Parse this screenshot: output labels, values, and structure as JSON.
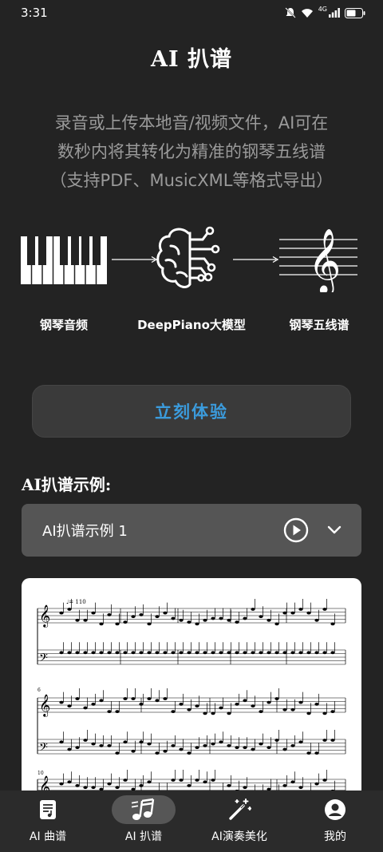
{
  "status": {
    "time": "3:31",
    "battery_icon": "battery-icon",
    "wifi_icon": "wifi-icon",
    "signal_icon": "signal-icon",
    "network_label": "4G"
  },
  "page": {
    "title": "AI 扒谱"
  },
  "description": [
    "录音或上传本地音/视频文件，AI可在",
    "数秒内将其转化为精准的钢琴五线谱",
    "（支持PDF、MusicXML等格式导出）"
  ],
  "pipeline": {
    "steps": [
      {
        "label": "钢琴音频",
        "icon": "piano-keys-icon"
      },
      {
        "label": "DeepPiano大模型",
        "icon": "brain-circuit-icon"
      },
      {
        "label": "钢琴五线谱",
        "icon": "treble-clef-staff-icon"
      }
    ]
  },
  "cta": {
    "label": "立刻体验"
  },
  "examples": {
    "section_title": "AI扒谱示例:",
    "selected": "AI扒谱示例 1",
    "tempo_mark": "♩= 110",
    "system_numbers": [
      "6",
      "10"
    ]
  },
  "nav": {
    "items": [
      {
        "label": "AI 曲谱",
        "icon": "score-book-icon",
        "active": false
      },
      {
        "label": "AI 扒谱",
        "icon": "music-notes-icon",
        "active": true
      },
      {
        "label": "AI演奏美化",
        "icon": "magic-wand-icon",
        "active": false
      },
      {
        "label": "我的",
        "icon": "user-avatar-icon",
        "active": false
      }
    ]
  },
  "colors": {
    "background": "#232323",
    "accent": "#3b9bdc",
    "card": "#555555"
  }
}
